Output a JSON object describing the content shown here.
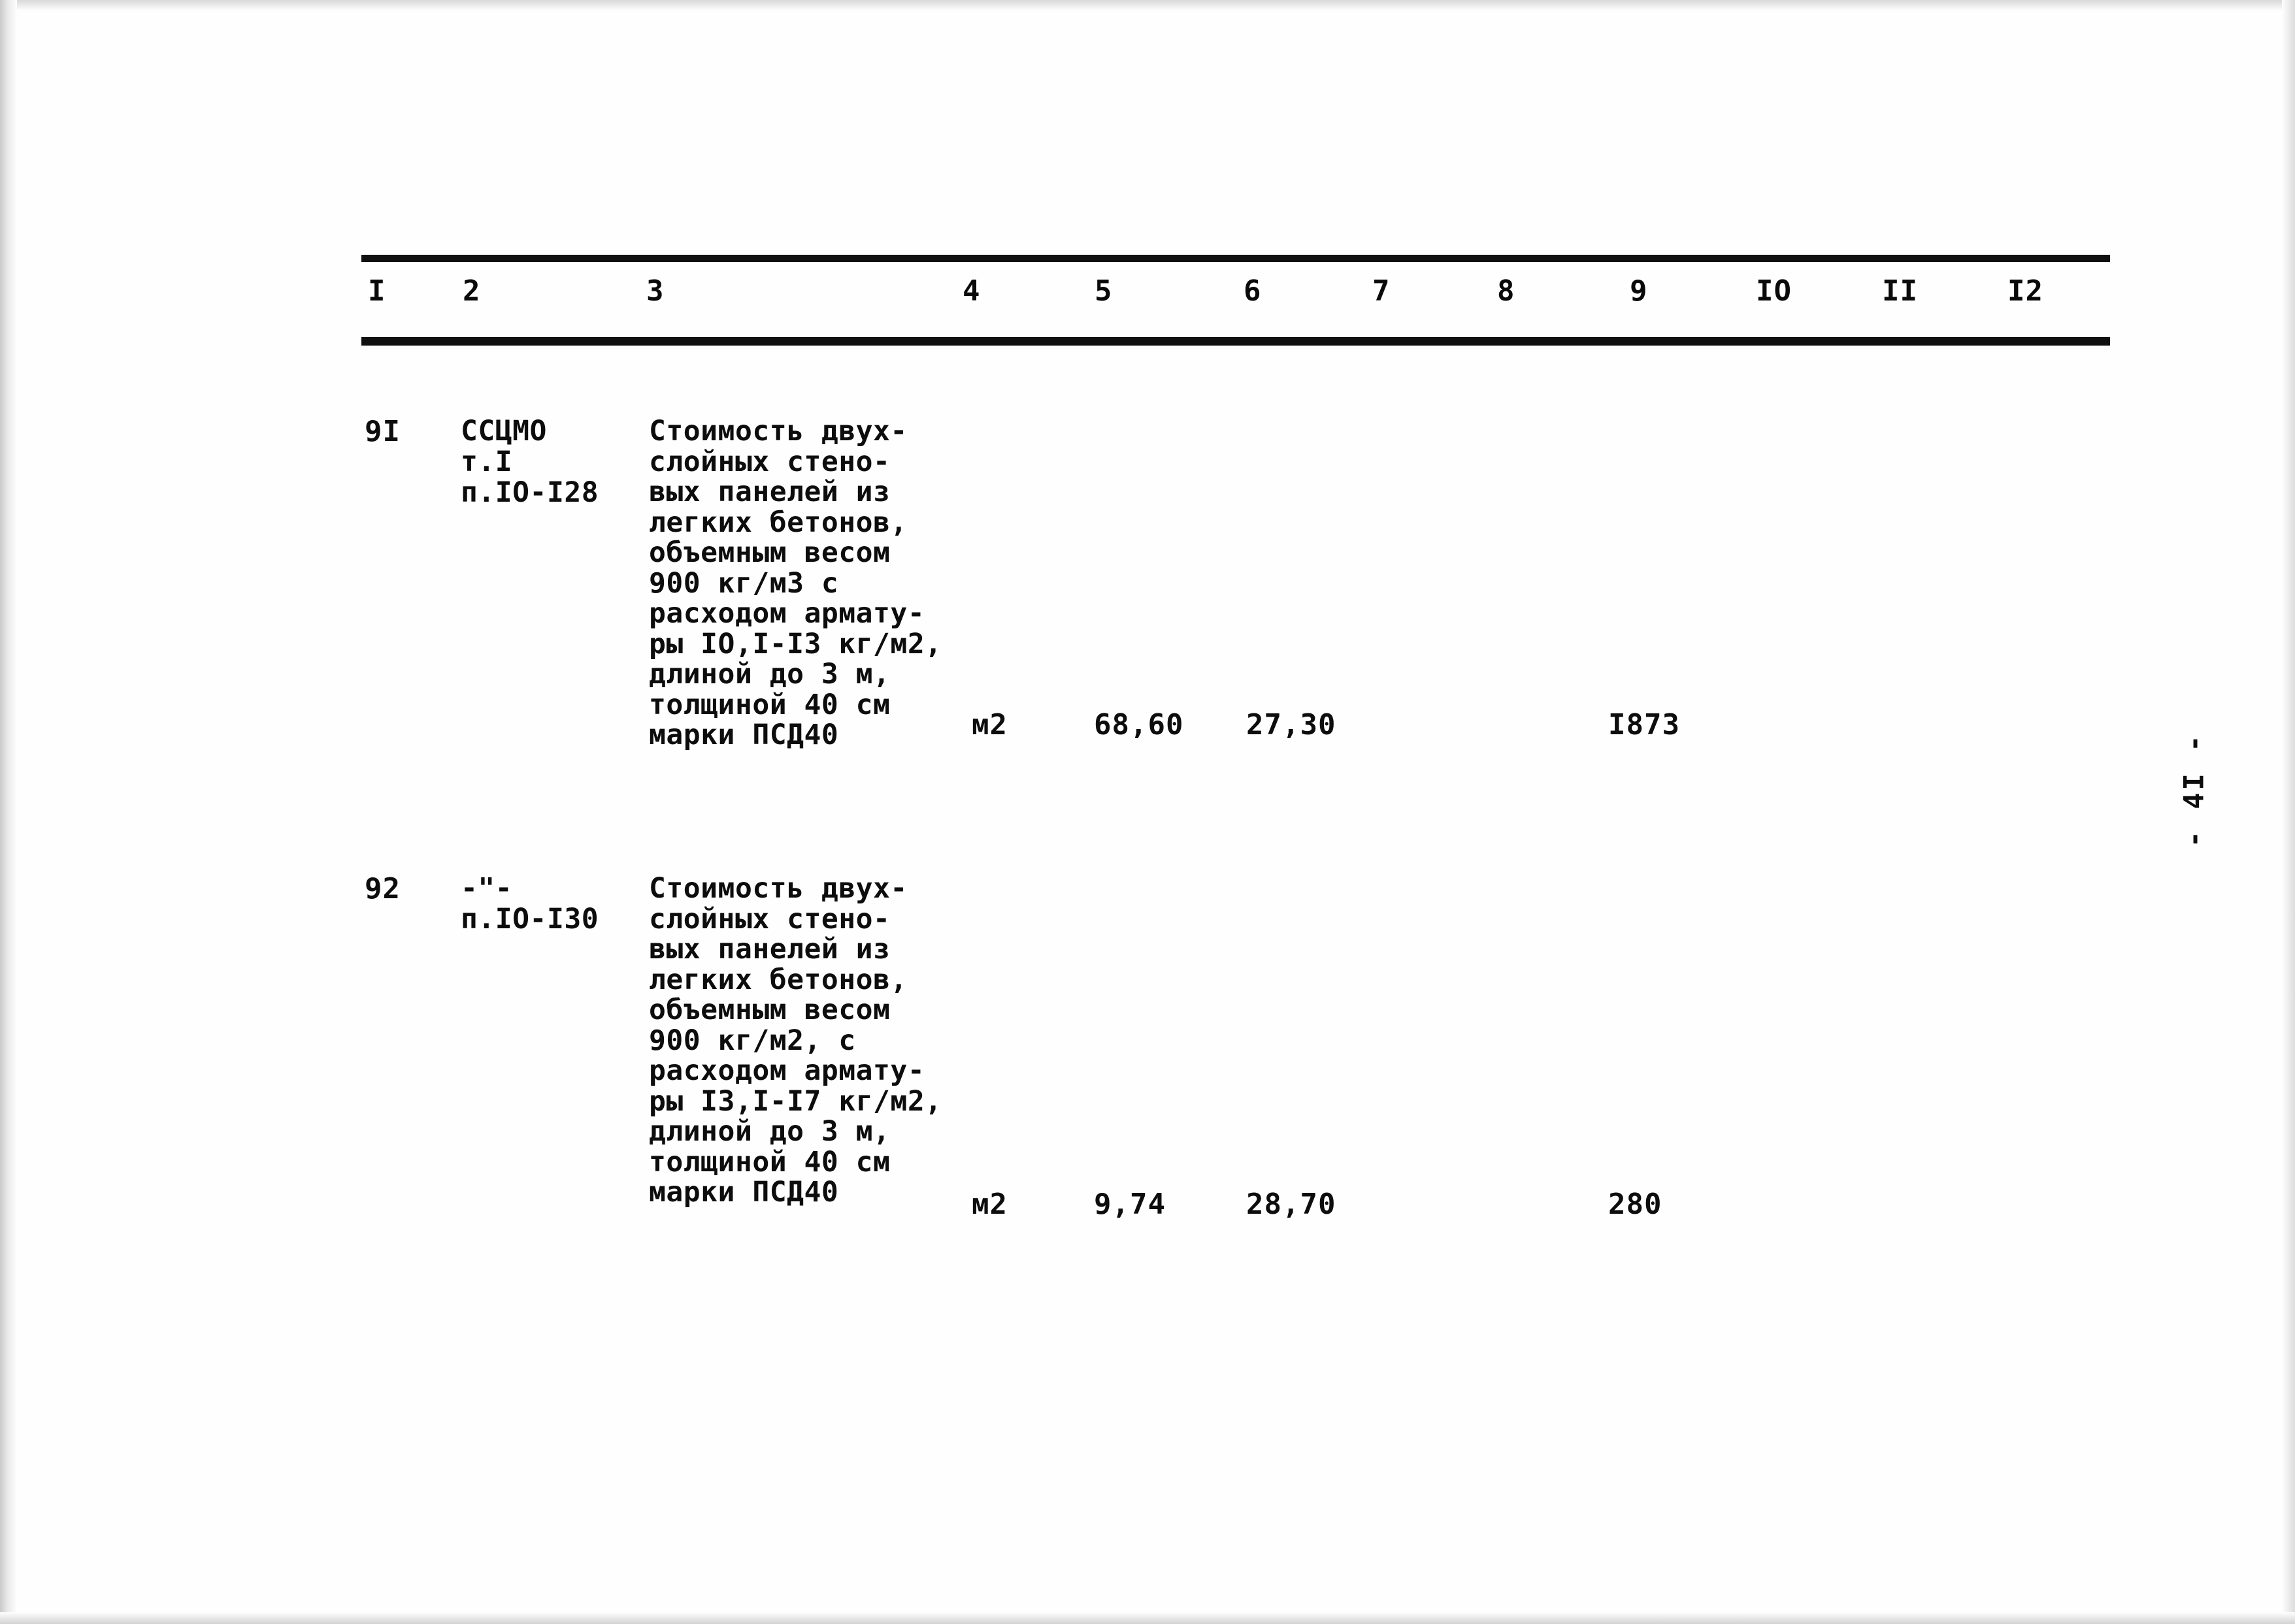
{
  "document": {
    "page_marker": "- 4I -",
    "type": "cost-estimate-table"
  },
  "table": {
    "column_headers": [
      "I",
      "2",
      "3",
      "4",
      "5",
      "6",
      "7",
      "8",
      "9",
      "IO",
      "II",
      "I2"
    ],
    "rows": [
      {
        "num": "9I",
        "source": "ССЦМО\nт.I\nп.IO-I28",
        "description": "Стоимость двух-\nслойных стено-\nвых панелей из\nлегких бетонов,\nобъемным весом\n900 кг/м3 с\nрасходом армату-\nры IO,I-I3 кг/м2,\nдлиной до 3 м,\nтолщиной 40 см\nмарки ПСД40",
        "unit": "м2",
        "col5": "68,60",
        "col6": "27,30",
        "col7": "",
        "col8": "",
        "col9": "I873",
        "col10": "",
        "col11": "",
        "col12": ""
      },
      {
        "num": "92",
        "source": "-\"-\nп.IO-I30",
        "description": "Стоимость двух-\nслойных стено-\nвых панелей из\nлегких бетонов,\nобъемным весом\n900 кг/м2, с\nрасходом армату-\nры I3,I-I7 кг/м2,\nдлиной до 3 м,\nтолщиной 40 см\nмарки ПСД40",
        "unit": "м2",
        "col5": "9,74",
        "col6": "28,70",
        "col7": "",
        "col8": "",
        "col9": "280",
        "col10": "",
        "col11": "",
        "col12": ""
      }
    ]
  }
}
